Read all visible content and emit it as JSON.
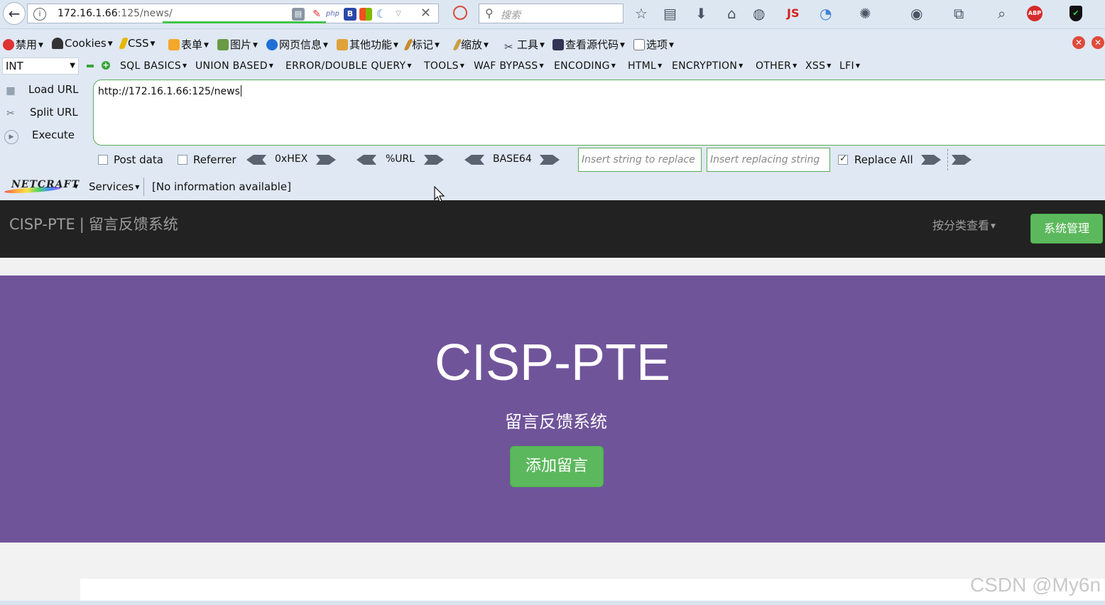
{
  "browser": {
    "url_host": "172.16.1.66",
    "url_path": ":125/news/",
    "search_placeholder": "搜索",
    "nav_icons": [
      "star-icon",
      "reading-list-icon",
      "download-icon",
      "home-icon",
      "globe-icon",
      "js-icon",
      "proxy-icon",
      "palette-icon",
      "network-icon",
      "share-icon",
      "zoom-icon",
      "adblock-icon",
      "shield-icon"
    ],
    "js_label": "JS",
    "abp_label": "ABP"
  },
  "menubar": {
    "items": [
      {
        "label": "禁用",
        "icon": "disable-icon"
      },
      {
        "label": "Cookies",
        "icon": "user-icon"
      },
      {
        "label": "CSS",
        "icon": "pen-icon"
      },
      {
        "label": "表单",
        "icon": "form-icon"
      },
      {
        "label": "图片",
        "icon": "image-icon"
      },
      {
        "label": "网页信息",
        "icon": "info-icon"
      },
      {
        "label": "其他功能",
        "icon": "folder-icon"
      },
      {
        "label": "标记",
        "icon": "pencil-icon"
      },
      {
        "label": "缩放",
        "icon": "ruler-icon"
      },
      {
        "label": "工具",
        "icon": "tools-icon"
      },
      {
        "label": "查看源代码",
        "icon": "source-icon"
      },
      {
        "label": "选项",
        "icon": "options-icon"
      }
    ]
  },
  "hackbar": {
    "select_value": "INT",
    "menus": [
      "SQL BASICS",
      "UNION BASED",
      "ERROR/DOUBLE QUERY",
      "TOOLS",
      "WAF BYPASS",
      "ENCODING",
      "HTML",
      "ENCRYPTION",
      "OTHER",
      "XSS",
      "LFI"
    ],
    "actions": [
      {
        "label": "Load URL",
        "icon": "load-url-icon"
      },
      {
        "label": "Split URL",
        "icon": "split-url-icon"
      },
      {
        "label": "Execute",
        "icon": "execute-icon"
      }
    ],
    "url_value": "http://172.16.1.66:125/news",
    "post_data_label": "Post data",
    "referrer_label": "Referrer",
    "hex_label": "0xHEX",
    "url_enc_label": "%URL",
    "base64_label": "BASE64",
    "replace_placeholder": "Insert string to replace",
    "replacing_placeholder": "Insert replacing string",
    "replace_all_label": "Replace All",
    "post_data_checked": false,
    "referrer_checked": false,
    "replace_all_checked": true
  },
  "netcraft": {
    "logo": "NETCRAFT",
    "services_label": "Services",
    "info": "[No information available]"
  },
  "site": {
    "brand_main": "CISP-PTE",
    "brand_sep": "|",
    "brand_sub": "留言反馈系统",
    "category_menu": "按分类查看",
    "admin_button": "系统管理",
    "hero_title": "CISP-PTE",
    "hero_subtitle": "留言反馈系统",
    "add_button": "添加留言"
  },
  "watermark": "CSDN @My6n",
  "colors": {
    "hero": "#70549a",
    "site_nav": "#222222",
    "success": "#5cb85c",
    "hackbar_border": "#5aad5a"
  }
}
